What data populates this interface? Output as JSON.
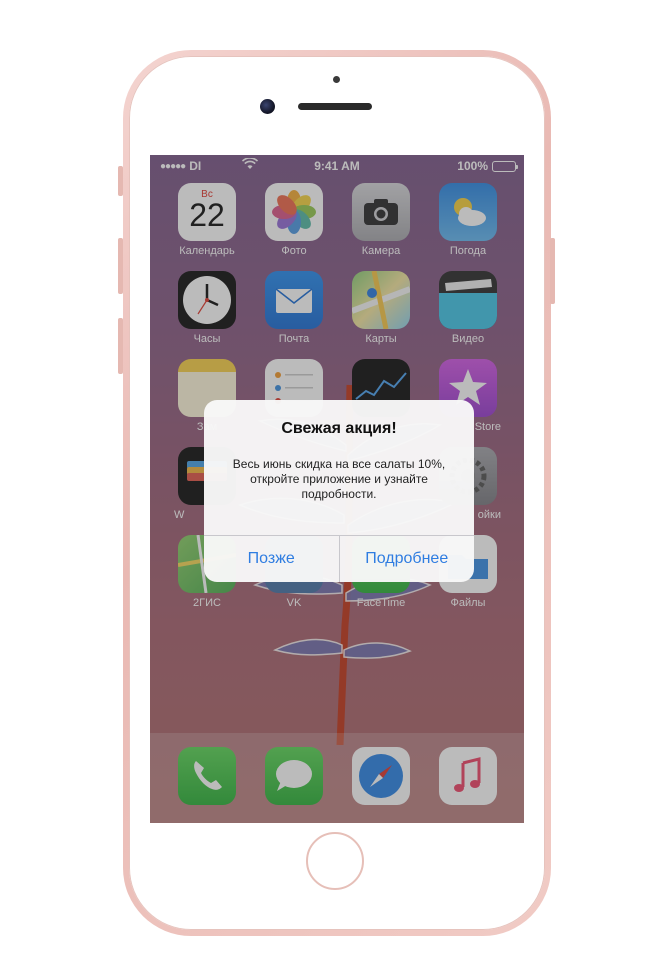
{
  "status_bar": {
    "signal": "●●●●●",
    "carrier": "DI",
    "time": "9:41 AM",
    "battery_percent": "100%",
    "wifi_icon": "wifi-icon",
    "battery_icon": "battery-icon"
  },
  "home_screen": {
    "apps": [
      {
        "label": "Календарь",
        "icon": "calendar-icon",
        "weekday": "Вс",
        "day": "22"
      },
      {
        "label": "Фото",
        "icon": "photos-icon"
      },
      {
        "label": "Камера",
        "icon": "camera-icon"
      },
      {
        "label": "Погода",
        "icon": "weather-icon"
      },
      {
        "label": "Часы",
        "icon": "clock-icon"
      },
      {
        "label": "Почта",
        "icon": "mail-icon"
      },
      {
        "label": "Карты",
        "icon": "maps-icon"
      },
      {
        "label": "Видео",
        "icon": "video-icon"
      },
      {
        "label": "Зам",
        "icon": "notes-icon"
      },
      {
        "label": "",
        "icon": "reminders-icon"
      },
      {
        "label": "",
        "icon": "stocks-icon"
      },
      {
        "label": "Store",
        "icon": "itunes-store-icon"
      },
      {
        "label": "W",
        "icon": "wallet-icon"
      },
      {
        "label": "ойки",
        "icon": "settings-icon"
      },
      {
        "label": "2ГИС",
        "icon": "2gis-icon"
      },
      {
        "label": "VK",
        "icon": "vk-icon"
      },
      {
        "label": "FaceTime",
        "icon": "facetime-icon"
      },
      {
        "label": "Файлы",
        "icon": "files-icon"
      }
    ],
    "dock": [
      {
        "icon": "phone-icon"
      },
      {
        "icon": "messages-icon"
      },
      {
        "icon": "safari-icon"
      },
      {
        "icon": "music-icon"
      }
    ]
  },
  "alert": {
    "title": "Свежая акция!",
    "message": "Весь июнь скидка на все салаты 10%, откройте приложение и узнайте подробности.",
    "buttons": {
      "later": "Позже",
      "details": "Подробнее"
    }
  },
  "colors": {
    "alert_button_text": "#2f7de1",
    "phone_frame": "#e9b9b3"
  }
}
